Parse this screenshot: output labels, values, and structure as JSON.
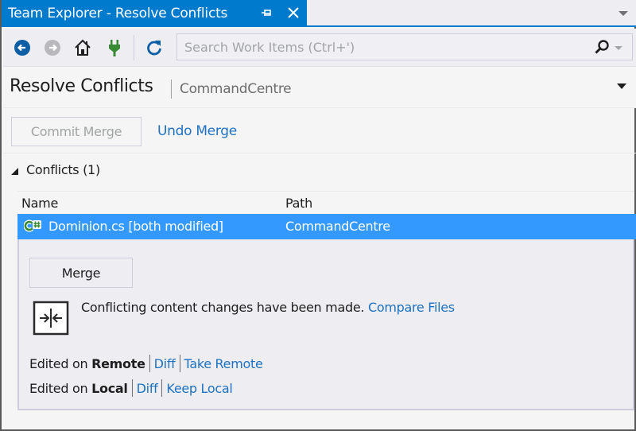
{
  "window": {
    "title": "Team Explorer - Resolve Conflicts",
    "pin_icon": "pin-icon",
    "close_icon": "close-icon",
    "dropdown_icon": "chevron-down-icon"
  },
  "toolbar": {
    "back_icon": "back-arrow-icon",
    "forward_icon": "forward-arrow-icon",
    "home_icon": "home-icon",
    "connect_icon": "plug-icon",
    "refresh_icon": "refresh-icon",
    "search_placeholder": "Search Work Items (Ctrl+')",
    "search_value": "",
    "search_icon": "search-icon"
  },
  "page": {
    "title": "Resolve Conflicts",
    "subtitle": "CommandCentre"
  },
  "actions": {
    "commit_merge": "Commit Merge",
    "undo_merge": "Undo Merge"
  },
  "conflicts": {
    "section_title": "Conflicts (1)",
    "columns": [
      "Name",
      "Path"
    ],
    "items": [
      {
        "name": "Dominion.cs [both modified]",
        "path": "CommandCentre",
        "icon": "csharp-file-icon",
        "selected": true
      }
    ]
  },
  "detail": {
    "merge_button": "Merge",
    "message": "Conflicting content changes have been made.",
    "compare_link": "Compare Files",
    "remote": {
      "prefix": "Edited on",
      "source": "Remote",
      "diff": "Diff",
      "take": "Take Remote"
    },
    "local": {
      "prefix": "Edited on",
      "source": "Local",
      "diff": "Diff",
      "keep": "Keep Local"
    }
  },
  "colors": {
    "accent": "#007acc",
    "selection": "#3399ff",
    "link": "#1e72c1",
    "panel": "#eeeef2"
  }
}
